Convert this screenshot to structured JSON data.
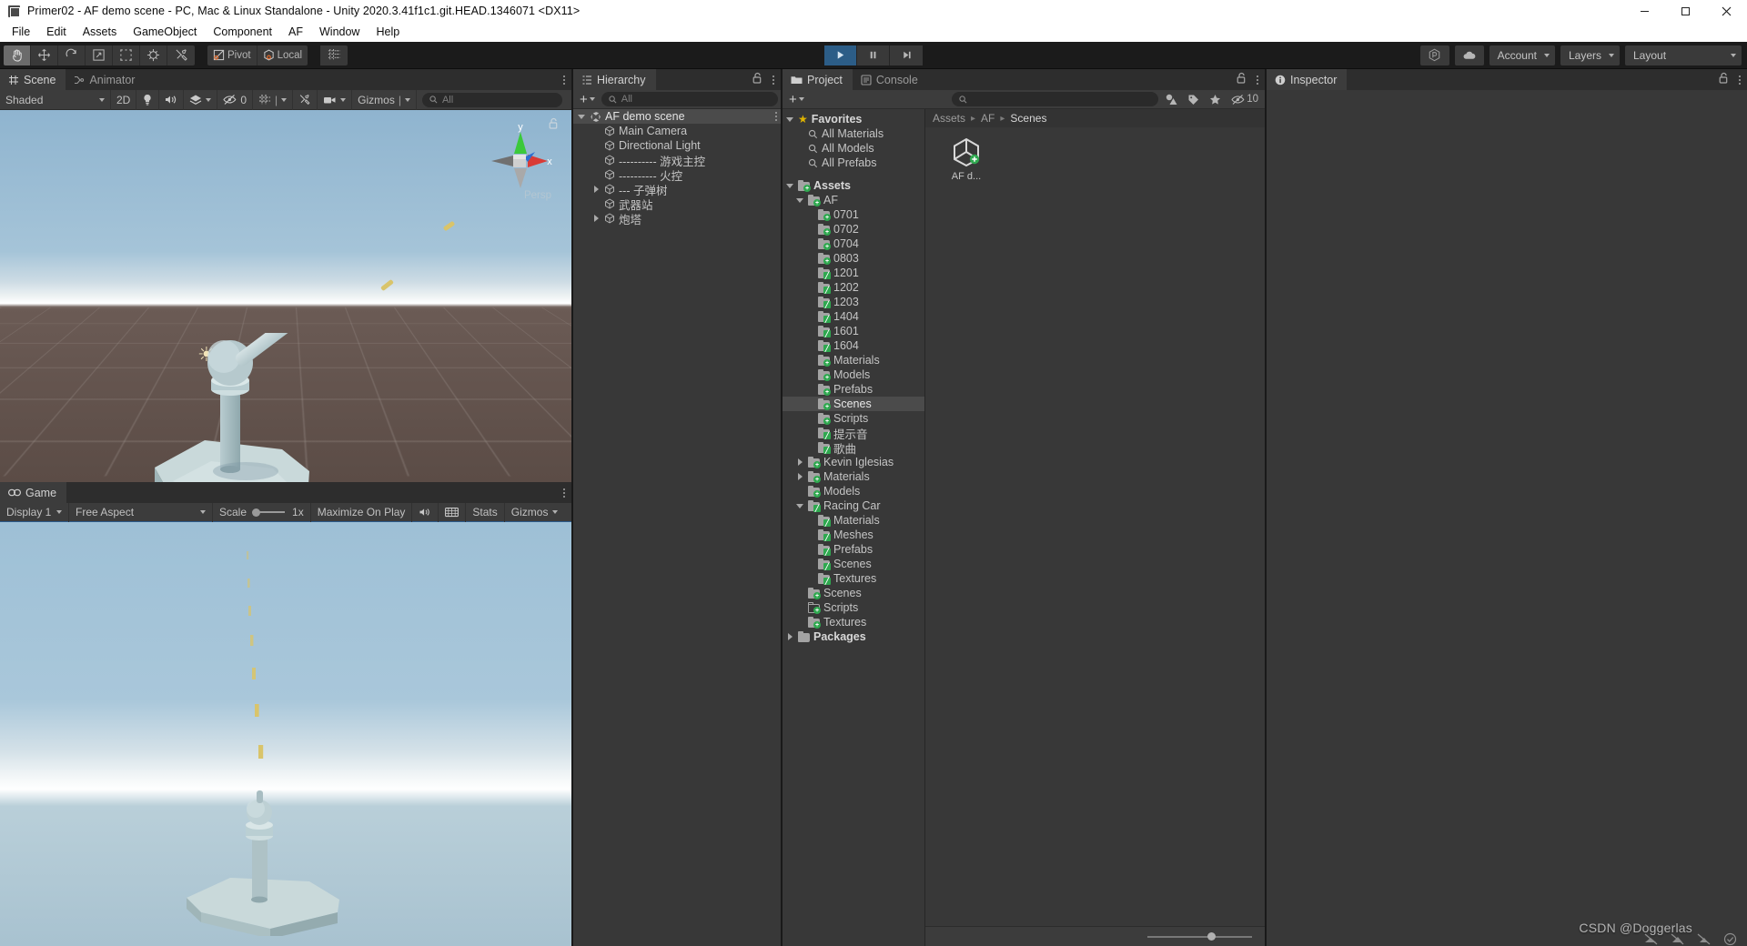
{
  "window": {
    "title": "Primer02 - AF demo scene - PC, Mac & Linux Standalone - Unity 2020.3.41f1c1.git.HEAD.1346071 <DX11>",
    "app_icon": "unity-icon",
    "minimize": "minimize-icon",
    "maximize": "maximize-icon",
    "close": "close-icon"
  },
  "menubar": {
    "items": [
      {
        "label": "File"
      },
      {
        "label": "Edit"
      },
      {
        "label": "Assets"
      },
      {
        "label": "GameObject"
      },
      {
        "label": "Component"
      },
      {
        "label": "AF"
      },
      {
        "label": "Window"
      },
      {
        "label": "Help"
      }
    ]
  },
  "toolbar": {
    "tools": [
      {
        "name": "hand-tool",
        "icon": "hand-icon",
        "active": true
      },
      {
        "name": "move-tool",
        "icon": "move-icon",
        "active": false
      },
      {
        "name": "rotate-tool",
        "icon": "rotate-icon",
        "active": false
      },
      {
        "name": "scale-tool",
        "icon": "scale-icon",
        "active": false
      },
      {
        "name": "rect-tool",
        "icon": "rect-icon",
        "active": false
      },
      {
        "name": "transform-tool",
        "icon": "transform-icon",
        "active": false
      },
      {
        "name": "custom-tool",
        "icon": "wrench-icon",
        "active": false
      }
    ],
    "pivot_label": "Pivot",
    "space_label": "Local",
    "snap_icon": "grid-snap-icon",
    "play": "play-icon",
    "pause": "pause-icon",
    "step": "step-icon",
    "play_active": true,
    "collab_icon": "collab-icon",
    "cloud_icon": "cloud-icon",
    "account_label": "Account",
    "layers_label": "Layers",
    "layout_label": "Layout"
  },
  "scene_view": {
    "tabs": [
      {
        "label": "Scene",
        "icon": "scene-grid-icon",
        "selected": true
      },
      {
        "label": "Animator",
        "icon": "animator-icon",
        "selected": false
      }
    ],
    "shading_mode": "Shaded",
    "mode_2d": "2D",
    "lighting_icon": "light-bulb-icon",
    "audio_icon": "audio-icon",
    "fx_icon": "effects-icon",
    "hidden_count": "0",
    "grid_icon": "grid-visibility-icon",
    "tools_icon": "scene-tools-icon",
    "camera_icon": "scene-camera-icon",
    "gizmos_label": "Gizmos",
    "search_placeholder": "All",
    "gizmo": {
      "x_label": "x",
      "y_label": "y",
      "projection_label": "Persp",
      "colors": {
        "x": "#d93b36",
        "y": "#3bc93b",
        "z": "#2f6fd0"
      }
    },
    "lock_icon": "lock-open-icon"
  },
  "game_view": {
    "tab_label": "Game",
    "tab_icon": "game-controller-icon",
    "display_label": "Display 1",
    "aspect_label": "Free Aspect",
    "scale_label": "Scale",
    "scale_value": "1x",
    "maximize_label": "Maximize On Play",
    "mute_icon": "mute-audio-icon",
    "stats_icon": "stats-icon",
    "stats_label": "Stats",
    "gizmos_label": "Gizmos"
  },
  "hierarchy": {
    "tab_label": "Hierarchy",
    "tab_icon": "hierarchy-icon",
    "lock_icon": "lock-open-icon",
    "add_label": "+",
    "search_placeholder": "All",
    "items": [
      {
        "label": "AF demo scene",
        "indent": 0,
        "arrow": "open",
        "icon": "unity-scene-icon",
        "selected": true,
        "kebab": true
      },
      {
        "label": "Main Camera",
        "indent": 2,
        "arrow": "none",
        "icon": "gameobject-icon",
        "selected": false,
        "kebab": false
      },
      {
        "label": "Directional Light",
        "indent": 2,
        "arrow": "none",
        "icon": "gameobject-icon",
        "selected": false,
        "kebab": false
      },
      {
        "label": "---------- 游戏主控",
        "indent": 2,
        "arrow": "none",
        "icon": "gameobject-icon",
        "selected": false,
        "kebab": false
      },
      {
        "label": "---------- 火控",
        "indent": 2,
        "arrow": "none",
        "icon": "gameobject-icon",
        "selected": false,
        "kebab": false
      },
      {
        "label": "--- 子弹树",
        "indent": 2,
        "arrow": "closed",
        "icon": "gameobject-icon",
        "selected": false,
        "kebab": false
      },
      {
        "label": "武器站",
        "indent": 2,
        "arrow": "none",
        "icon": "gameobject-icon",
        "selected": false,
        "kebab": false
      },
      {
        "label": "炮塔",
        "indent": 2,
        "arrow": "closed",
        "icon": "gameobject-icon",
        "selected": false,
        "kebab": false
      }
    ]
  },
  "project": {
    "tabs": [
      {
        "label": "Project",
        "icon": "folder-icon",
        "selected": true
      },
      {
        "label": "Console",
        "icon": "console-icon",
        "selected": false
      }
    ],
    "lock_icon": "lock-open-icon",
    "add_label": "+",
    "search_placeholder": "",
    "filter_type_icon": "filter-type-icon",
    "filter_label_icon": "filter-label-icon",
    "favorite_icon": "star-icon",
    "hidden_icon": "hidden-packages-icon",
    "hidden_count": "10",
    "breadcrumb": [
      "Assets",
      "AF",
      "Scenes"
    ],
    "assets": [
      {
        "label": "AF d...",
        "icon": "unity-scene-asset-icon"
      }
    ],
    "zoom_value": 62,
    "tree": [
      {
        "label": "Favorites",
        "indent": 0,
        "arrow": "open",
        "icon": "star",
        "bold": true,
        "selected": false
      },
      {
        "label": "All Materials",
        "indent": 1,
        "arrow": "none",
        "icon": "search",
        "bold": false,
        "selected": false
      },
      {
        "label": "All Models",
        "indent": 1,
        "arrow": "none",
        "icon": "search",
        "bold": false,
        "selected": false
      },
      {
        "label": "All Prefabs",
        "indent": 1,
        "arrow": "none",
        "icon": "search",
        "bold": false,
        "selected": false
      },
      {
        "label": "",
        "indent": 0,
        "arrow": "none",
        "icon": "spacer",
        "bold": false,
        "selected": false
      },
      {
        "label": "Assets",
        "indent": 0,
        "arrow": "open",
        "icon": "folder-plus",
        "bold": true,
        "selected": false
      },
      {
        "label": "AF",
        "indent": 1,
        "arrow": "open",
        "icon": "folder-plus",
        "bold": false,
        "selected": false
      },
      {
        "label": "0701",
        "indent": 2,
        "arrow": "none",
        "icon": "folder-plus",
        "bold": false,
        "selected": false
      },
      {
        "label": "0702",
        "indent": 2,
        "arrow": "none",
        "icon": "folder-plus",
        "bold": false,
        "selected": false
      },
      {
        "label": "0704",
        "indent": 2,
        "arrow": "none",
        "icon": "folder-plus",
        "bold": false,
        "selected": false
      },
      {
        "label": "0803",
        "indent": 2,
        "arrow": "none",
        "icon": "folder-plus",
        "bold": false,
        "selected": false
      },
      {
        "label": "1201",
        "indent": 2,
        "arrow": "none",
        "icon": "folder-edit",
        "bold": false,
        "selected": false
      },
      {
        "label": "1202",
        "indent": 2,
        "arrow": "none",
        "icon": "folder-edit",
        "bold": false,
        "selected": false
      },
      {
        "label": "1203",
        "indent": 2,
        "arrow": "none",
        "icon": "folder-edit",
        "bold": false,
        "selected": false
      },
      {
        "label": "1404",
        "indent": 2,
        "arrow": "none",
        "icon": "folder-edit",
        "bold": false,
        "selected": false
      },
      {
        "label": "1601",
        "indent": 2,
        "arrow": "none",
        "icon": "folder-edit",
        "bold": false,
        "selected": false
      },
      {
        "label": "1604",
        "indent": 2,
        "arrow": "none",
        "icon": "folder-edit",
        "bold": false,
        "selected": false
      },
      {
        "label": "Materials",
        "indent": 2,
        "arrow": "none",
        "icon": "folder-plus",
        "bold": false,
        "selected": false
      },
      {
        "label": "Models",
        "indent": 2,
        "arrow": "none",
        "icon": "folder-plus",
        "bold": false,
        "selected": false
      },
      {
        "label": "Prefabs",
        "indent": 2,
        "arrow": "none",
        "icon": "folder-plus",
        "bold": false,
        "selected": false
      },
      {
        "label": "Scenes",
        "indent": 2,
        "arrow": "none",
        "icon": "folder-plus",
        "bold": false,
        "selected": true
      },
      {
        "label": "Scripts",
        "indent": 2,
        "arrow": "none",
        "icon": "folder-plus",
        "bold": false,
        "selected": false
      },
      {
        "label": "提示音",
        "indent": 2,
        "arrow": "none",
        "icon": "folder-edit",
        "bold": false,
        "selected": false
      },
      {
        "label": "歌曲",
        "indent": 2,
        "arrow": "none",
        "icon": "folder-edit",
        "bold": false,
        "selected": false
      },
      {
        "label": "Kevin Iglesias",
        "indent": 1,
        "arrow": "closed",
        "icon": "folder-plus",
        "bold": false,
        "selected": false
      },
      {
        "label": "Materials",
        "indent": 1,
        "arrow": "closed",
        "icon": "folder-plus",
        "bold": false,
        "selected": false
      },
      {
        "label": "Models",
        "indent": 1,
        "arrow": "none",
        "icon": "folder-plus",
        "bold": false,
        "selected": false
      },
      {
        "label": "Racing Car",
        "indent": 1,
        "arrow": "open",
        "icon": "folder-edit",
        "bold": false,
        "selected": false
      },
      {
        "label": "Materials",
        "indent": 2,
        "arrow": "none",
        "icon": "folder-edit",
        "bold": false,
        "selected": false
      },
      {
        "label": "Meshes",
        "indent": 2,
        "arrow": "none",
        "icon": "folder-edit",
        "bold": false,
        "selected": false
      },
      {
        "label": "Prefabs",
        "indent": 2,
        "arrow": "none",
        "icon": "folder-edit",
        "bold": false,
        "selected": false
      },
      {
        "label": "Scenes",
        "indent": 2,
        "arrow": "none",
        "icon": "folder-edit",
        "bold": false,
        "selected": false
      },
      {
        "label": "Textures",
        "indent": 2,
        "arrow": "none",
        "icon": "folder-edit",
        "bold": false,
        "selected": false
      },
      {
        "label": "Scenes",
        "indent": 1,
        "arrow": "none",
        "icon": "folder-plus",
        "bold": false,
        "selected": false
      },
      {
        "label": "Scripts",
        "indent": 1,
        "arrow": "none",
        "icon": "folder-outline",
        "bold": false,
        "selected": false
      },
      {
        "label": "Textures",
        "indent": 1,
        "arrow": "none",
        "icon": "folder-plus",
        "bold": false,
        "selected": false
      },
      {
        "label": "Packages",
        "indent": 0,
        "arrow": "closed",
        "icon": "folder-plain",
        "bold": true,
        "selected": false
      }
    ]
  },
  "inspector": {
    "tab_label": "Inspector",
    "tab_icon": "info-icon",
    "lock_icon": "lock-open-icon"
  },
  "watermark": {
    "text": "CSDN @Doggerlas"
  },
  "colors": {
    "panel_bg": "#383838",
    "tab_bg": "#2d2d2d",
    "toolbar_bg": "#3c3c3c",
    "selection": "#4b4b4b",
    "play_active": "#2c5d87",
    "folder_badge_green": "#2fa84f",
    "favorites_star": "#e0b400"
  }
}
